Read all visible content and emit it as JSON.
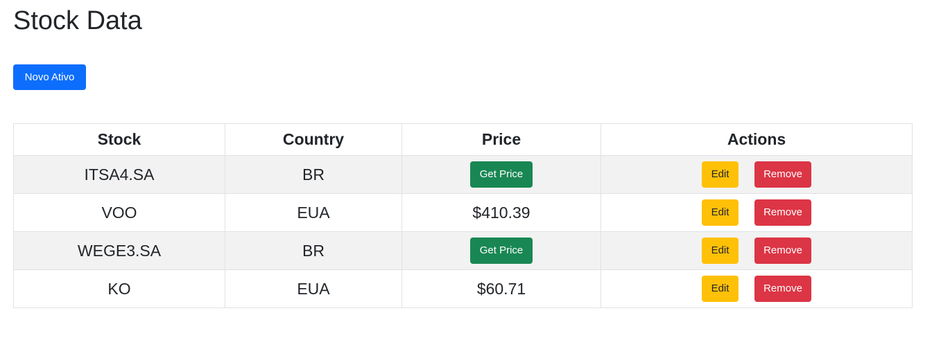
{
  "page": {
    "title": "Stock Data",
    "new_button_label": "Novo Ativo"
  },
  "table": {
    "headers": {
      "stock": "Stock",
      "country": "Country",
      "price": "Price",
      "actions": "Actions"
    },
    "rows": [
      {
        "stock": "ITSA4.SA",
        "country": "BR",
        "price": null,
        "price_button": "Get Price",
        "edit": "Edit",
        "remove": "Remove"
      },
      {
        "stock": "VOO",
        "country": "EUA",
        "price": "$410.39",
        "price_button": null,
        "edit": "Edit",
        "remove": "Remove"
      },
      {
        "stock": "WEGE3.SA",
        "country": "BR",
        "price": null,
        "price_button": "Get Price",
        "edit": "Edit",
        "remove": "Remove"
      },
      {
        "stock": "KO",
        "country": "EUA",
        "price": "$60.71",
        "price_button": null,
        "edit": "Edit",
        "remove": "Remove"
      }
    ]
  },
  "colors": {
    "primary": "#0d6efd",
    "success": "#198754",
    "warning": "#ffc107",
    "danger": "#dc3545",
    "stripe": "#f2f2f2"
  }
}
